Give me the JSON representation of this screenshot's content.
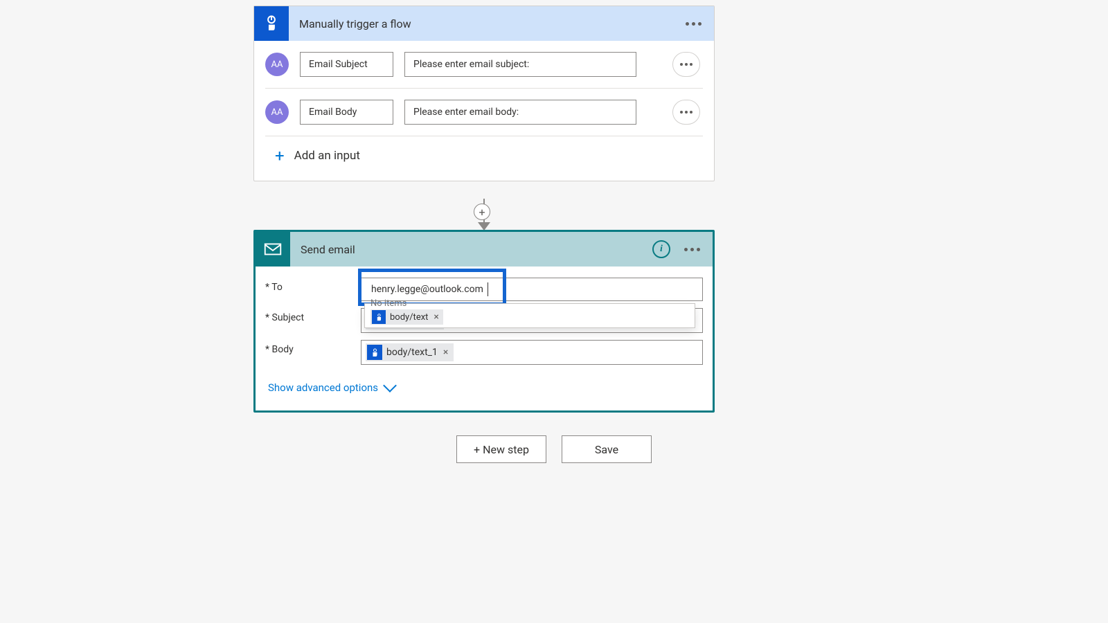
{
  "trigger": {
    "title": "Manually trigger a flow",
    "type_badge": "AA",
    "inputs": [
      {
        "name": "Email Subject",
        "prompt": "Please enter email subject:"
      },
      {
        "name": "Email Body",
        "prompt": "Please enter email body:"
      }
    ],
    "add_input_label": "Add an input"
  },
  "send": {
    "title": "Send email",
    "labels": {
      "to": "To",
      "subject": "Subject",
      "body": "Body"
    },
    "to_value": "henry.legge@outlook.com",
    "no_items": "No items",
    "token_subject": "body/text",
    "token_body": "body/text_1",
    "advanced": "Show advanced options"
  },
  "buttons": {
    "new_step": "+ New step",
    "save": "Save"
  }
}
